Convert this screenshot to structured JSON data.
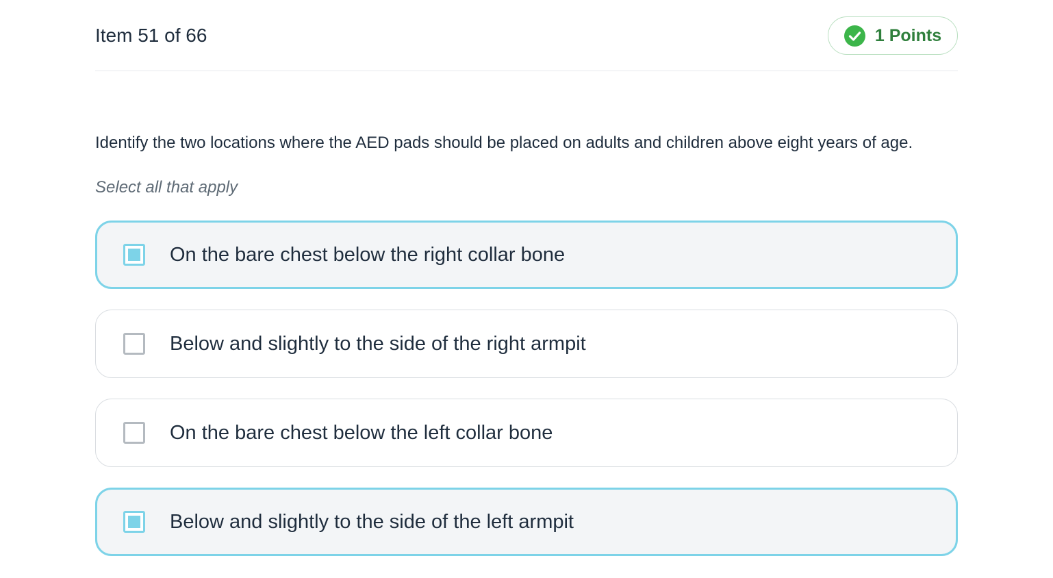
{
  "header": {
    "item_counter": "Item 51 of 66",
    "points_label": "1 Points",
    "points_icon": "check-circle-icon",
    "points_color": "#2f7f3c",
    "points_icon_color": "#3cb54a"
  },
  "question": {
    "text": "Identify the two locations where the AED pads should be placed on adults and children above eight years of age.",
    "instruction": "Select all that apply"
  },
  "options": [
    {
      "label": "On the bare chest below the right collar bone",
      "selected": true
    },
    {
      "label": "Below and slightly to the side of the right armpit",
      "selected": false
    },
    {
      "label": "On the bare chest below the left collar bone",
      "selected": false
    },
    {
      "label": "Below and slightly to the side of the left armpit",
      "selected": true
    }
  ],
  "colors": {
    "selected_border": "#7dd3e8",
    "selected_background": "#f3f5f7",
    "unselected_border": "#d9dde1"
  }
}
